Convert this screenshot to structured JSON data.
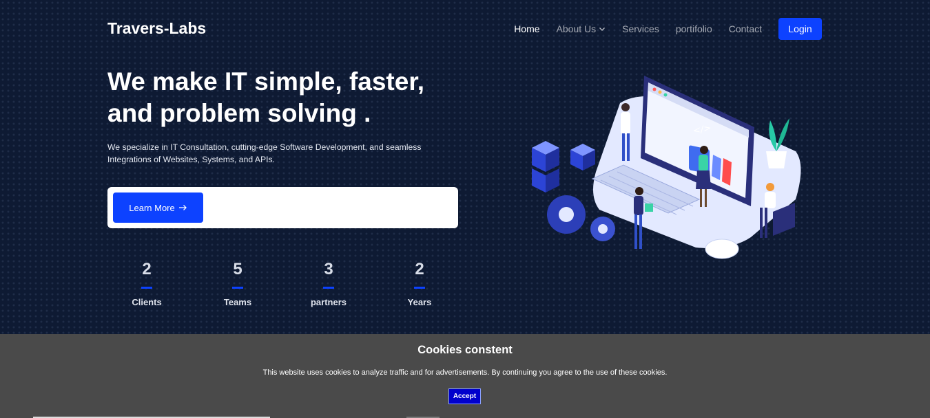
{
  "header": {
    "logo": "Travers-Labs",
    "nav": [
      {
        "label": "Home",
        "active": true
      },
      {
        "label": "About Us",
        "dropdown": true
      },
      {
        "label": "Services"
      },
      {
        "label": "portifolio"
      },
      {
        "label": "Contact"
      }
    ],
    "login_label": "Login"
  },
  "hero": {
    "title_line1": "We make IT simple, faster,",
    "title_line2": "and problem solving .",
    "subtitle": "We specialize in IT Consultation, cutting-edge Software Development, and seamless Integrations of Websites, Systems, and APIs.",
    "cta_label": "Learn More",
    "cta_icon": "arrow-right-icon"
  },
  "stats": [
    {
      "value": "2",
      "label": "Clients"
    },
    {
      "value": "5",
      "label": "Teams"
    },
    {
      "value": "3",
      "label": "partners"
    },
    {
      "value": "2",
      "label": "Years"
    }
  ],
  "cookie": {
    "title": "Cookies constent",
    "text": "This website uses cookies to analyze traffic and for advertisements. By continuing you agree to the use of these cookies.",
    "accept_label": "Accept"
  },
  "colors": {
    "background": "#0e1a33",
    "accent": "#0d42ff",
    "cookie_bg": "#4a4a4a",
    "accept_bg": "#0000cc"
  }
}
